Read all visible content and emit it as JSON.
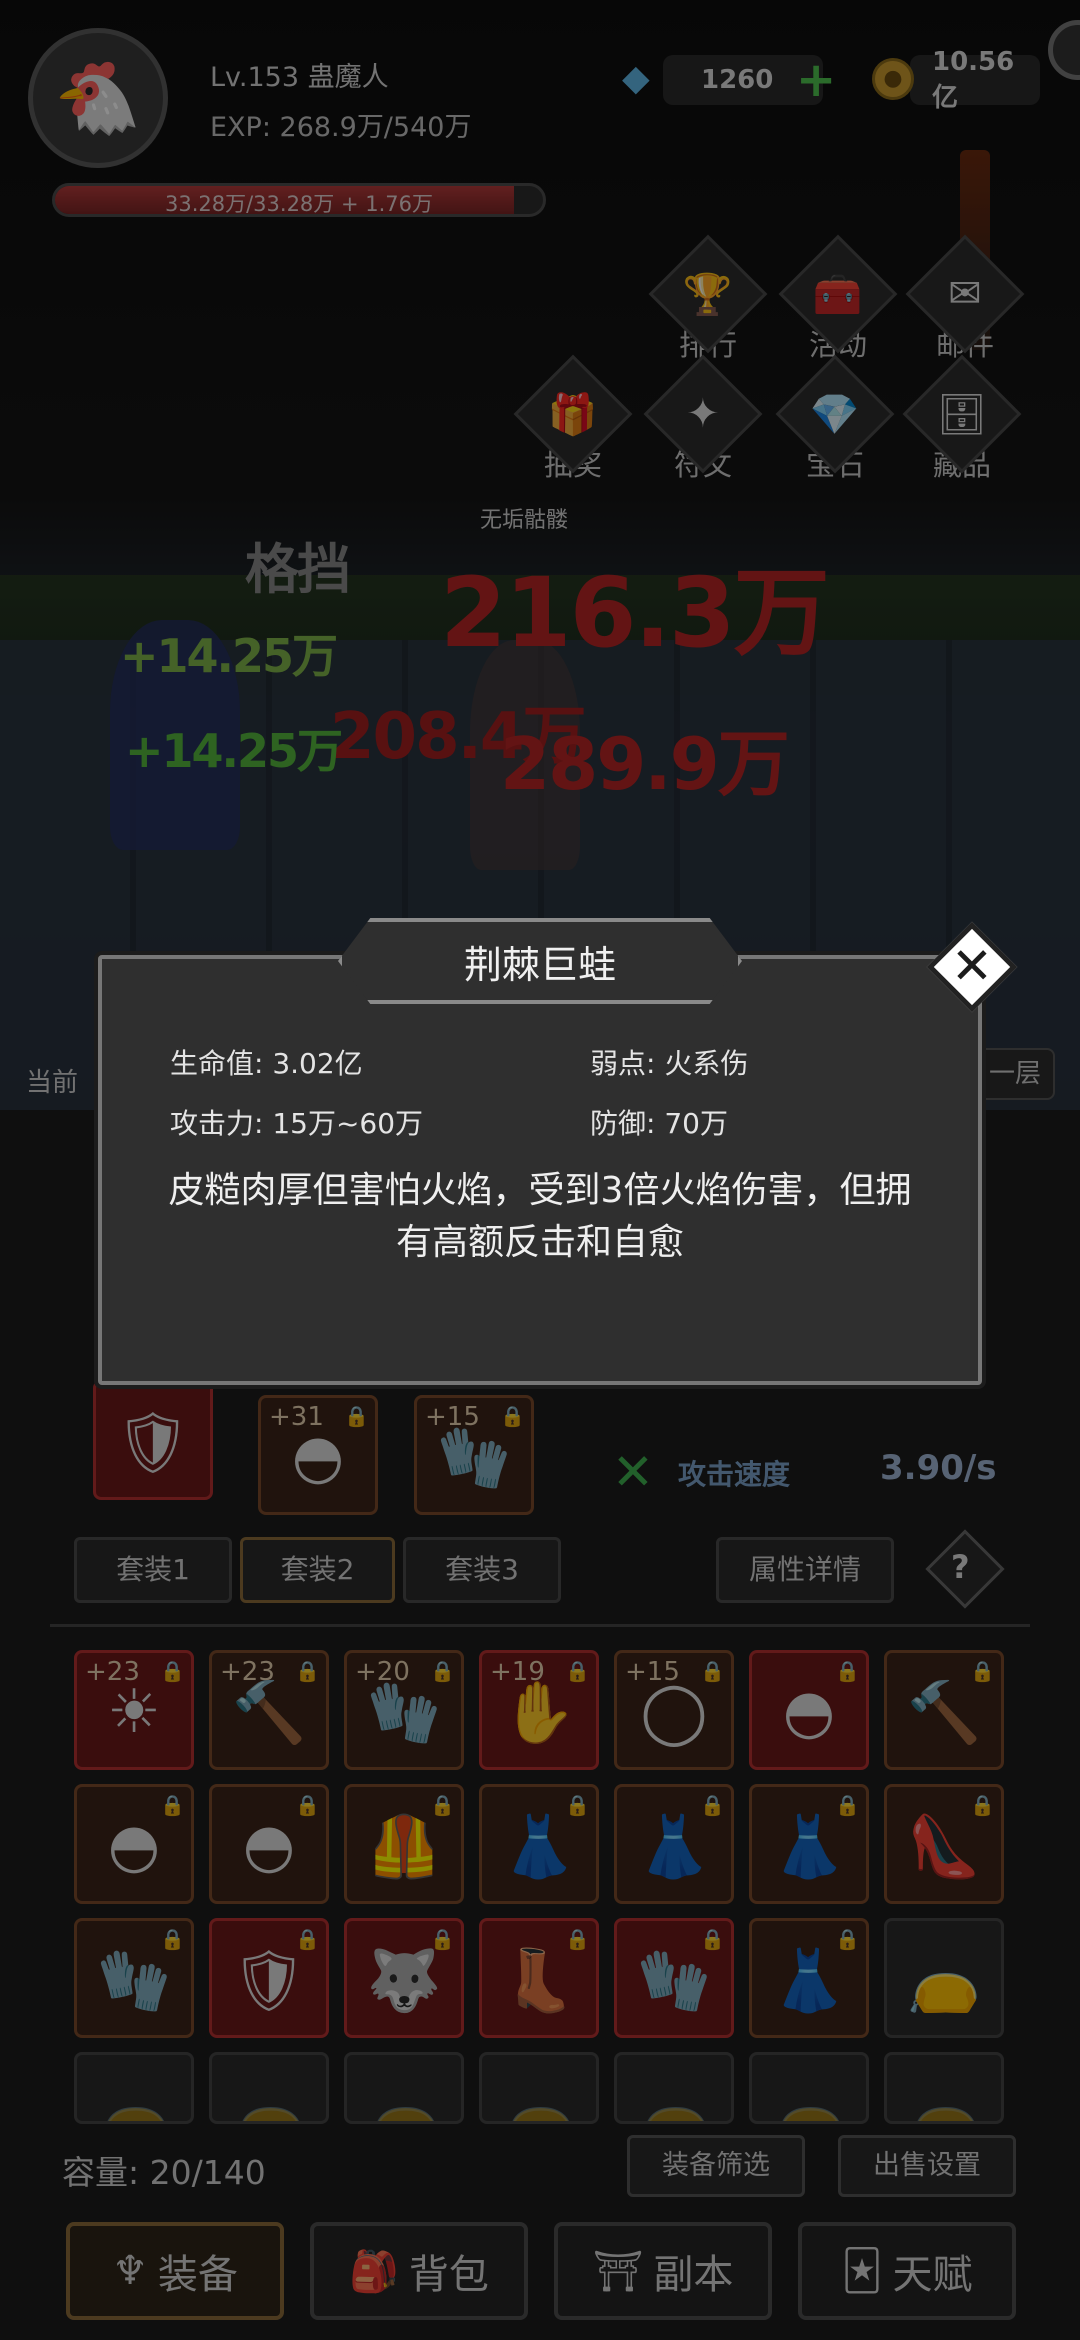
{
  "header": {
    "level_name": "Lv.153 蛊魔人",
    "exp": "EXP: 268.9万/540万",
    "hp_text": "33.28万/33.28万 + 1.76万",
    "hp_fill": 1.0,
    "gems": "1260",
    "gold": "10.56亿",
    "plus": "+"
  },
  "menu": [
    {
      "label": "排行",
      "icon": "trophy-icon"
    },
    {
      "label": "活动",
      "icon": "chest-icon"
    },
    {
      "label": "邮件",
      "icon": "mail-icon"
    },
    {
      "label": "抽奖",
      "icon": "gift-icon"
    },
    {
      "label": "符文",
      "icon": "rune-icon"
    },
    {
      "label": "宝石",
      "icon": "gem-icon"
    },
    {
      "label": "藏品",
      "icon": "collection-icon"
    }
  ],
  "battle": {
    "enemy_label": "无垢骷髅",
    "block_text": "格挡",
    "damage": [
      "216.3万",
      "208.4万",
      "289.9万"
    ],
    "heal": [
      "+14.25万",
      "+14.25万"
    ],
    "current_floor": "当前",
    "layer_button": "一层"
  },
  "modal": {
    "title": "荆棘巨蛙",
    "hp": "生命值: 3.02亿",
    "weakness": "弱点: 火系伤",
    "attack": "攻击力: 15万~60万",
    "defense": "防御: 70万",
    "description": "皮糙肉厚但害怕火焰，受到3倍火焰伤害，但拥有高额反击和自愈",
    "close": "✕"
  },
  "equipped": [
    {
      "level": "",
      "icon": "shield-icon"
    },
    {
      "level": "+31",
      "icon": "hood-icon"
    },
    {
      "level": "+15",
      "icon": "gauntlet-icon"
    }
  ],
  "attack_speed": {
    "label": "攻击速度",
    "value": "3.90/s"
  },
  "sets": [
    "套装1",
    "套装2",
    "套装3"
  ],
  "attr_detail": "属性详情",
  "help": "?",
  "inventory": [
    {
      "level": "+23",
      "rarity": "red",
      "icon": "sun-amulet-icon"
    },
    {
      "level": "+23",
      "rarity": "orange",
      "icon": "hammer-icon"
    },
    {
      "level": "+20",
      "rarity": "orange",
      "icon": "gauntlet-icon"
    },
    {
      "level": "+19",
      "rarity": "red",
      "icon": "glove-icon"
    },
    {
      "level": "+15",
      "rarity": "orange",
      "icon": "ring-icon"
    },
    {
      "level": "",
      "rarity": "red",
      "icon": "hood-icon"
    },
    {
      "level": "",
      "rarity": "orange",
      "icon": "hammer-icon"
    },
    {
      "level": "",
      "rarity": "orange",
      "icon": "hood-icon"
    },
    {
      "level": "",
      "rarity": "orange",
      "icon": "hood-icon"
    },
    {
      "level": "",
      "rarity": "orange",
      "icon": "armor-icon"
    },
    {
      "level": "",
      "rarity": "orange",
      "icon": "bodysuit-icon"
    },
    {
      "level": "",
      "rarity": "orange",
      "icon": "bodysuit-icon"
    },
    {
      "level": "",
      "rarity": "orange",
      "icon": "bodysuit-icon"
    },
    {
      "level": "",
      "rarity": "orange",
      "icon": "shoe-icon"
    },
    {
      "level": "",
      "rarity": "orange",
      "icon": "gauntlet-icon"
    },
    {
      "level": "",
      "rarity": "red",
      "icon": "shield-icon"
    },
    {
      "level": "",
      "rarity": "red",
      "icon": "wolf-amulet-icon"
    },
    {
      "level": "",
      "rarity": "red",
      "icon": "boot-icon"
    },
    {
      "level": "",
      "rarity": "red",
      "icon": "gauntlet-icon"
    },
    {
      "level": "",
      "rarity": "orange",
      "icon": "bodysuit-icon"
    },
    {
      "level": "",
      "rarity": "gray",
      "icon": "bag-icon"
    }
  ],
  "capacity": "容量: 20/140",
  "filter_button": "装备筛选",
  "sell_button": "出售设置",
  "nav": [
    {
      "label": "装备",
      "icon": "trident-icon"
    },
    {
      "label": "背包",
      "icon": "backpack-icon"
    },
    {
      "label": "副本",
      "icon": "gate-icon"
    },
    {
      "label": "天赋",
      "icon": "cards-icon"
    }
  ]
}
